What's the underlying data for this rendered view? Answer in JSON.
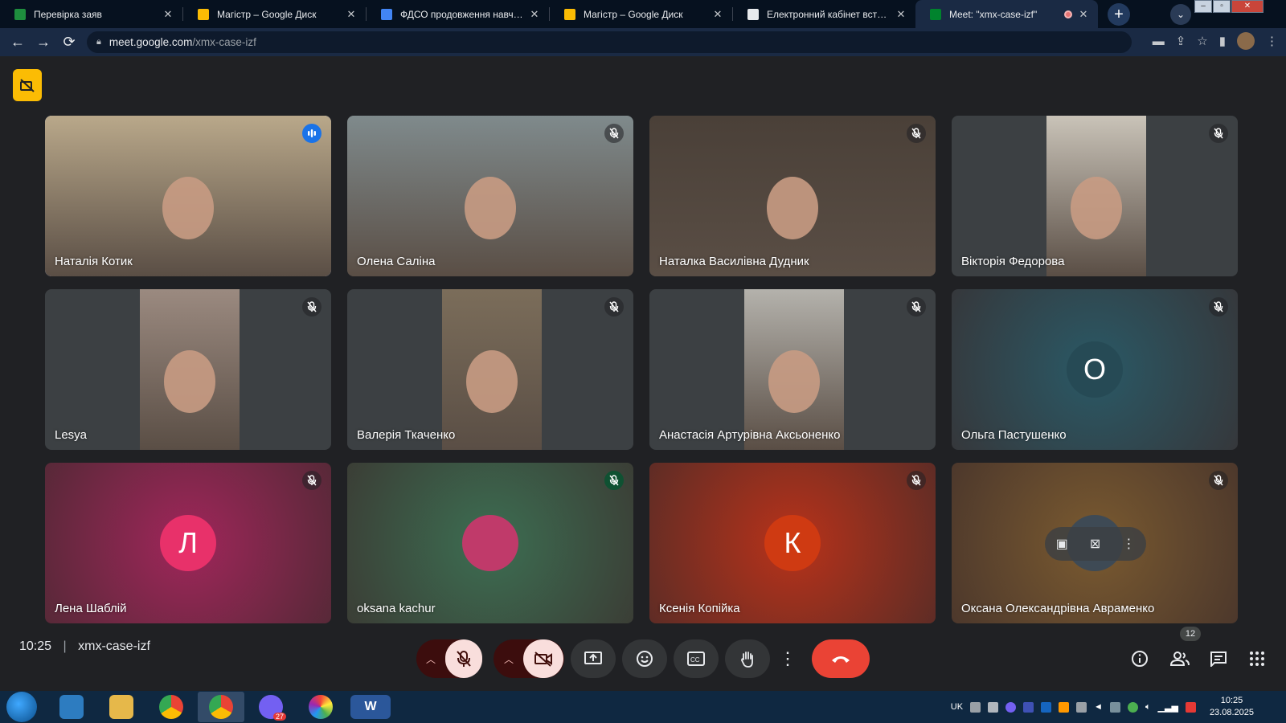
{
  "browser": {
    "tabs": [
      {
        "title": "Перевірка заяв",
        "favicon_color": "#1e8e3e"
      },
      {
        "title": "Магістр – Google Диск",
        "favicon_color": "#fbbc04"
      },
      {
        "title": "ФДСО продовження навчання",
        "favicon_color": "#4285f4"
      },
      {
        "title": "Магістр – Google Диск",
        "favicon_color": "#fbbc04"
      },
      {
        "title": "Електронний кабінет вступника",
        "favicon_color": "#e8eaed"
      },
      {
        "title": "Meet: \"xmx-case-izf\"",
        "favicon_color": "#00832d"
      }
    ],
    "url_host": "meet.google.com",
    "url_path": "/xmx-case-izf"
  },
  "participants": [
    {
      "name": "Наталія Котик",
      "mic": "speaking",
      "kind": "video",
      "bg": "#b9a88a"
    },
    {
      "name": "Олена Саліна",
      "mic": "muted",
      "kind": "video",
      "bg": "#7f8a8c"
    },
    {
      "name": "Наталка Василівна Дудник",
      "mic": "muted",
      "kind": "video",
      "bg": "#4a4038"
    },
    {
      "name": "Вікторія Федорова",
      "mic": "muted",
      "kind": "video",
      "bg": "#c9c3b8"
    },
    {
      "name": "Lesya",
      "mic": "muted",
      "kind": "video",
      "bg": "#9b8a80"
    },
    {
      "name": "Валерія Ткаченко",
      "mic": "muted",
      "kind": "video",
      "bg": "#7b6d5a"
    },
    {
      "name": "Анастасія Артурівна Аксьоненко",
      "mic": "muted",
      "kind": "video",
      "bg": "#b4b2ac"
    },
    {
      "name": "Ольга Пастушенко",
      "mic": "muted",
      "kind": "avatar",
      "initial": "О",
      "bg": "#2a5966",
      "avatar_bg": "#264a55"
    },
    {
      "name": "Лена Шаблій",
      "mic": "muted",
      "kind": "avatar",
      "initial": "Л",
      "bg": "#a0265a",
      "avatar_bg": "#e8316a"
    },
    {
      "name": "oksana kachur",
      "mic": "muted",
      "kind": "photo",
      "bg": "#3c6e52",
      "avatar_bg": "#c03a6a"
    },
    {
      "name": "Ксенія Копійка",
      "mic": "muted",
      "kind": "avatar",
      "initial": "К",
      "bg": "#b8321a",
      "avatar_bg": "#cf3a12"
    },
    {
      "name": "Оксана Олександрівна Авраменко",
      "mic": "muted",
      "kind": "photo",
      "bg": "#7a5a30",
      "avatar_bg": "#3e4a55"
    }
  ],
  "bottom_bar": {
    "time": "10:25",
    "meeting_code": "xmx-case-izf",
    "people_count": "12"
  },
  "taskbar": {
    "language": "UK",
    "clock_time": "10:25",
    "clock_date": "23.08.2025",
    "viber_badge": "27"
  }
}
